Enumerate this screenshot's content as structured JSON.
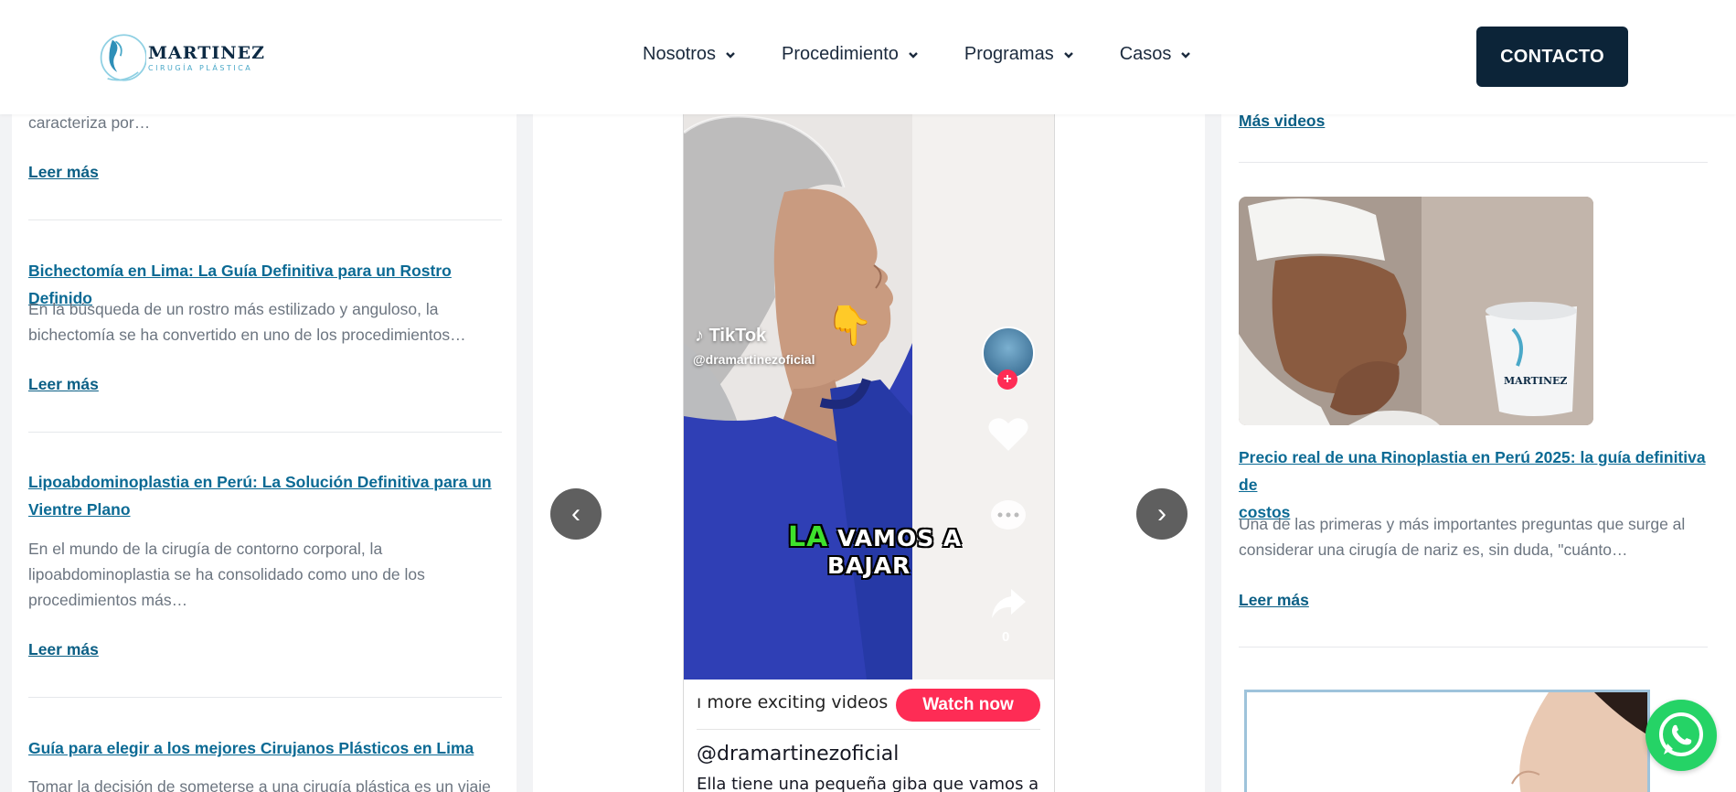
{
  "header": {
    "logo_name": "MARTINEZ",
    "logo_subtitle": "CIRUGÍA PLÁSTICA",
    "nav": [
      {
        "label": "Nosotros"
      },
      {
        "label": "Procedimiento"
      },
      {
        "label": "Programas"
      },
      {
        "label": "Casos"
      }
    ],
    "contact_label": "CONTACTO"
  },
  "left_column": {
    "top_excerpt": "caracteriza por…",
    "top_read_more": "Leer más",
    "posts": [
      {
        "title": "Bichectomía en Lima: La Guía Definitiva para un Rostro Definido",
        "excerpt_lines": [
          "En la búsqueda de un rostro más estilizado y anguloso, la",
          "bichectomía se ha convertido en uno de los procedimientos…"
        ],
        "read_more": "Leer más"
      },
      {
        "title_lines": [
          "Lipoabdominoplastia en Perú: La Solución Definitiva para un",
          "Vientre Plano"
        ],
        "excerpt_lines": [
          "En el mundo de la cirugía de contorno corporal, la",
          "lipoabdominoplastia se ha consolidado como uno de los",
          "procedimientos más…"
        ],
        "read_more": "Leer más"
      },
      {
        "title": "Guía para elegir a los mejores Cirujanos Plásticos en Lima",
        "excerpt_lines": [
          "Tomar la decisión de someterse a una cirugía plástica es un viaje"
        ]
      }
    ]
  },
  "tiktok": {
    "brand": "TikTok",
    "overlay_handle": "@dramartinezoficial",
    "caption_highlight": "LA",
    "caption_line1": "VAMOS A",
    "caption_line2": "BAJAR",
    "share_count": "0",
    "bottom_text": "ı more exciting videos",
    "watch_label": "Watch now",
    "handle": "@dramartinezoficial",
    "description": "Ella tiene una pequeña giba que vamos a"
  },
  "right_column": {
    "more_videos": "Más videos",
    "post": {
      "title_lines": [
        "Precio real de una Rinoplastia en Perú 2025: la guía definitiva de",
        "costos"
      ],
      "excerpt_lines": [
        "Una de las primeras y más importantes preguntas que surge al",
        "considerar una cirugía de nariz es, sin duda, \"cuánto…"
      ],
      "read_more": "Leer más"
    },
    "mug_text": "MARTINEZ"
  },
  "colors": {
    "brand_dark": "#0c2438",
    "link": "#0b6a94",
    "tiktok_red": "#fe2c55",
    "whatsapp": "#25d366"
  }
}
